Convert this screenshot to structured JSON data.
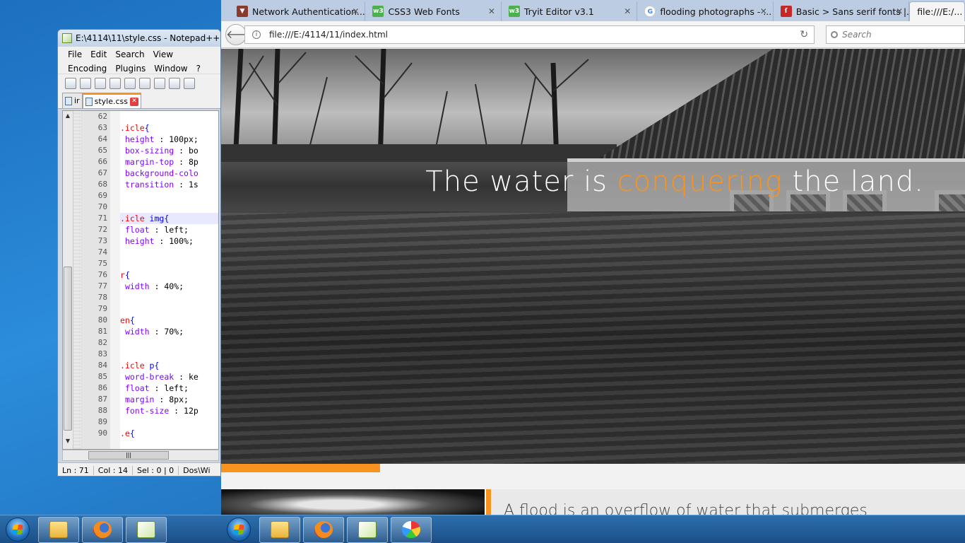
{
  "notepad": {
    "title": "E:\\4114\\11\\style.css - Notepad++",
    "menu": [
      "File",
      "Edit",
      "Search",
      "View",
      "Encoding",
      "Plugins",
      "Window",
      "?"
    ],
    "tabs": [
      {
        "label": "ir"
      },
      {
        "label": "style.css"
      }
    ],
    "lines": [
      {
        "n": "62",
        "code": ""
      },
      {
        "n": "63",
        "sel": ".icle",
        "rest": "{"
      },
      {
        "n": "64",
        "prop": "height",
        "val": " : 100px;"
      },
      {
        "n": "65",
        "prop": "box-sizing",
        "val": " : bo"
      },
      {
        "n": "66",
        "prop": "margin-top",
        "val": " : 8p"
      },
      {
        "n": "67",
        "prop": "background-colo",
        "val": ""
      },
      {
        "n": "68",
        "prop": "transition",
        "val": " : 1s"
      },
      {
        "n": "69",
        "code": ""
      },
      {
        "n": "70",
        "code": ""
      },
      {
        "n": "71",
        "sel": ".icle",
        "rest": " img{"
      },
      {
        "n": "72",
        "prop": "float",
        "val": " : left;"
      },
      {
        "n": "73",
        "prop": "height",
        "val": " : 100%;"
      },
      {
        "n": "74",
        "code": ""
      },
      {
        "n": "75",
        "code": ""
      },
      {
        "n": "76",
        "sel": "r",
        "rest": "{"
      },
      {
        "n": "77",
        "prop": "width",
        "val": " : 40%;"
      },
      {
        "n": "78",
        "code": ""
      },
      {
        "n": "79",
        "code": ""
      },
      {
        "n": "80",
        "sel": "en",
        "rest": "{"
      },
      {
        "n": "81",
        "prop": "width",
        "val": " : 70%;"
      },
      {
        "n": "82",
        "code": ""
      },
      {
        "n": "83",
        "code": ""
      },
      {
        "n": "84",
        "sel": ".icle",
        "rest": " p{"
      },
      {
        "n": "85",
        "prop": "word-break",
        "val": " : ke"
      },
      {
        "n": "86",
        "prop": "float",
        "val": " : left;"
      },
      {
        "n": "87",
        "prop": "margin",
        "val": " : 8px;"
      },
      {
        "n": "88",
        "prop": "font-size",
        "val": " : 12p"
      },
      {
        "n": "89",
        "code": ""
      },
      {
        "n": "90",
        "sel": ".e",
        "rest": "{"
      }
    ],
    "status": {
      "ln": "Ln : 71",
      "col": "Col : 14",
      "sel": "Sel : 0 | 0",
      "eol": "Dos\\Wi"
    }
  },
  "browser": {
    "tabs": [
      {
        "label": "Network Authentication...",
        "icon": "shield-icon",
        "color": "#8a3b2b"
      },
      {
        "label": "CSS3 Web Fonts",
        "icon": "w3-icon",
        "color": "#4caf50"
      },
      {
        "label": "Tryit Editor v3.1",
        "icon": "w3-icon",
        "color": "#4caf50"
      },
      {
        "label": "flooding photographs - ...",
        "icon": "google-icon",
        "color": "#4285f4"
      },
      {
        "label": "Basic > Sans serif fonts |...",
        "icon": "fontsquirrel-icon",
        "color": "#c62828"
      }
    ],
    "active_tab": "file:///E:/...",
    "url": "file:///E:/4114/11/index.html",
    "search_placeholder": "Search"
  },
  "page": {
    "headline_before": "The water is ",
    "headline_accent": "conquering",
    "headline_after": " the land.",
    "accent_color": "#f7931e",
    "progress": 0.214,
    "paragraph": "A flood is an overflow of water that submerges"
  }
}
